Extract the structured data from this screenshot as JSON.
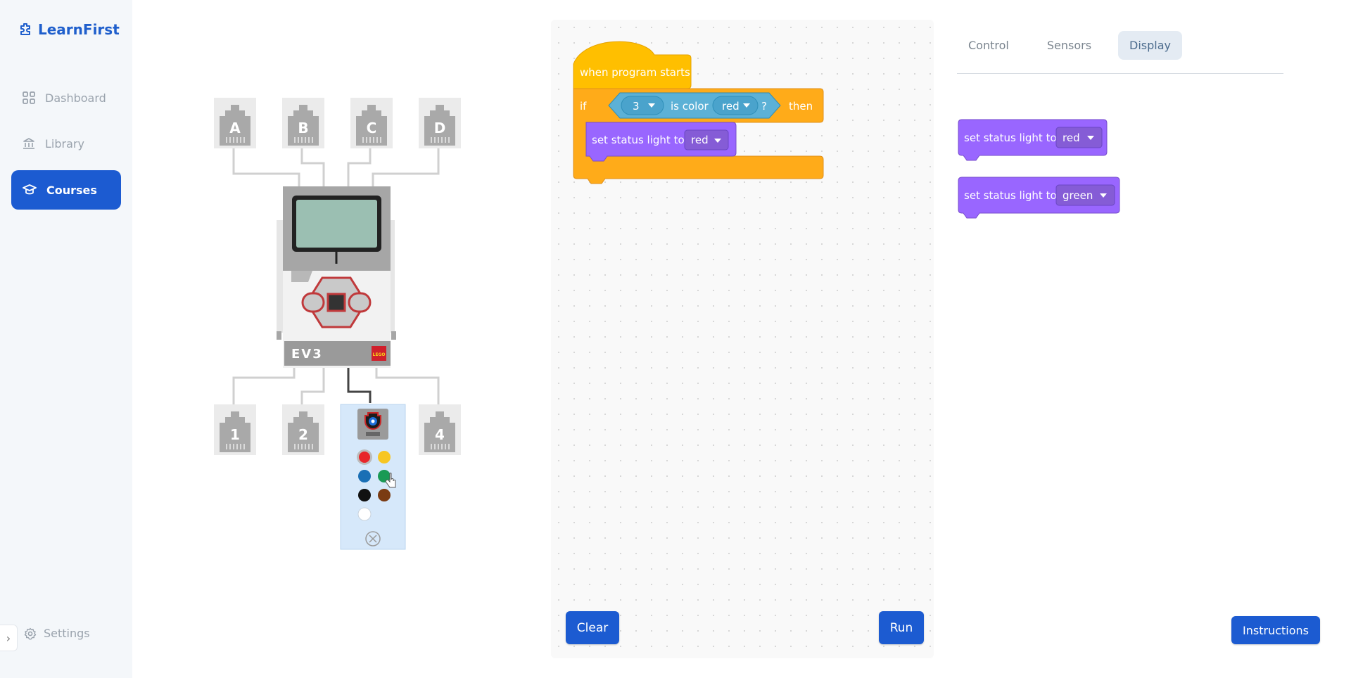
{
  "app": {
    "name": "LearnFirst"
  },
  "sidebar": {
    "items": [
      {
        "label": "Dashboard",
        "icon": "grid-icon"
      },
      {
        "label": "Library",
        "icon": "library-icon"
      },
      {
        "label": "Courses",
        "icon": "graduation-cap-icon",
        "active": true
      }
    ],
    "settings_label": "Settings"
  },
  "robot": {
    "brick_label": "EV3",
    "brand_badge": "LEGO",
    "output_ports": [
      "A",
      "B",
      "C",
      "D"
    ],
    "input_ports": [
      "1",
      "2",
      "3",
      "4"
    ],
    "sensor_panel": {
      "port": "3",
      "sensor": "color sensor",
      "selected_color": "red",
      "color_options": [
        {
          "name": "red",
          "hex": "#e8262a"
        },
        {
          "name": "yellow",
          "hex": "#f7c623"
        },
        {
          "name": "blue",
          "hex": "#1a6fb5"
        },
        {
          "name": "green",
          "hex": "#1a9a55"
        },
        {
          "name": "black",
          "hex": "#111111"
        },
        {
          "name": "brown",
          "hex": "#7a3b13"
        },
        {
          "name": "white",
          "hex": "#ffffff"
        }
      ]
    }
  },
  "program": {
    "hat_label": "when program starts",
    "if_label": "if",
    "then_label": "then",
    "condition": {
      "port": "3",
      "text": "is color",
      "color": "red",
      "suffix": "?"
    },
    "action": {
      "label": "set status light to",
      "value": "red"
    }
  },
  "workspace_buttons": {
    "clear": "Clear",
    "run": "Run"
  },
  "palette": {
    "tabs": [
      "Control",
      "Sensors",
      "Display"
    ],
    "active_tab": "Display",
    "blocks": [
      {
        "label": "set status light to",
        "value": "red"
      },
      {
        "label": "set status light to",
        "value": "green"
      }
    ]
  },
  "instructions_button": "Instructions",
  "colors": {
    "brand": "#1c5bd1",
    "event_block": "#ffbf00",
    "control_block": "#ffab19",
    "sensor_block": "#5cb1d6",
    "looks_block": "#9966ff"
  }
}
